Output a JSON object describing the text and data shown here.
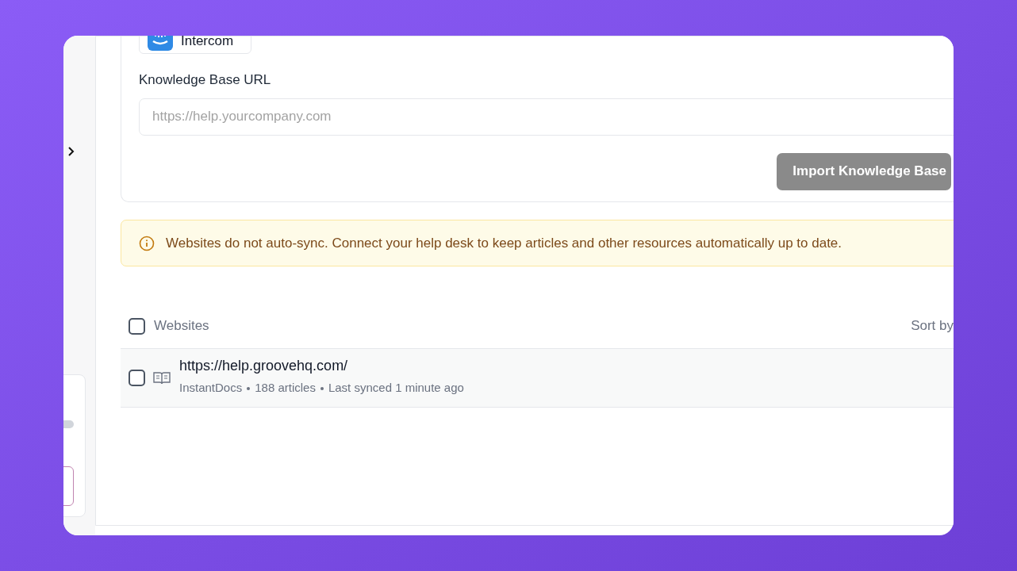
{
  "integration": {
    "label": "Intercom"
  },
  "url_field": {
    "label": "Knowledge Base URL",
    "placeholder": "https://help.yourcompany.com"
  },
  "import_button": {
    "label": "Import Knowledge Base",
    "disabled": true
  },
  "notice": {
    "text": "Websites do not auto-sync. Connect your help desk to keep articles and other resources automatically up to date."
  },
  "list_header": {
    "label": "Websites",
    "checked": false,
    "sort_label": "Sort by"
  },
  "websites": [
    {
      "url": "https://help.groovehq.com/",
      "source": "InstantDocs",
      "articles": "188 articles",
      "synced": "Last synced 1 minute ago",
      "checked": false
    }
  ]
}
